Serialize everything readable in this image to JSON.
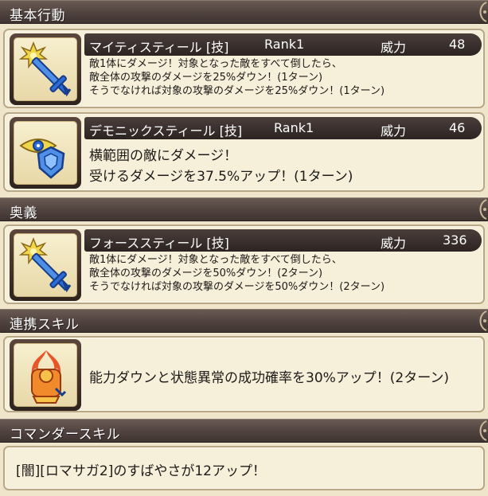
{
  "sections": {
    "basic_actions": "基本行動",
    "ougi": "奥義",
    "renkei": "連携スキル",
    "commander": "コマンダースキル"
  },
  "skills": [
    {
      "name": "マイティスティール [技]",
      "rank": "Rank1",
      "power_label": "威力",
      "power": "48",
      "lines": [
        "敵1体にダメージ！対象となった敵をすべて倒したら、",
        "敵全体の攻撃のダメージを25%ダウン！(1ターン)",
        "そうでなければ対象の攻撃のダメージを25%ダウン！(1ターン)"
      ],
      "icon": "sword-burst-icon"
    },
    {
      "name": "デモニックスティール [技]",
      "rank": "Rank1",
      "power_label": "威力",
      "power": "46",
      "lines": [
        "横範囲の敵にダメージ！",
        "受けるダメージを37.5%アップ！(1ターン)"
      ],
      "icon": "eye-shield-icon"
    },
    {
      "name": "フォーススティール [技]",
      "rank": "",
      "power_label": "威力",
      "power": "336",
      "lines": [
        "敵1体にダメージ！対象となった敵をすべて倒したら、",
        "敵全体の攻撃のダメージを50%ダウン！(2ターン)",
        "そうでなければ対象の攻撃のダメージを50%ダウン！(2ターン)"
      ],
      "icon": "sword-burst-icon"
    }
  ],
  "renkei_skill": {
    "text": "能力ダウンと状態異常の成功確率を30%アップ！(2ターン)",
    "icon": "flame-hand-icon"
  },
  "commander_skill": {
    "text": "[闇][ロマサガ2]のすばやさが12アップ！"
  },
  "colors": {
    "header_bg": "#4f423e",
    "card_bg": "#f6efda",
    "bar_bg": "#2c2422",
    "accent_gold": "#f2d64a",
    "icon_blue": "#2d6bd6"
  }
}
